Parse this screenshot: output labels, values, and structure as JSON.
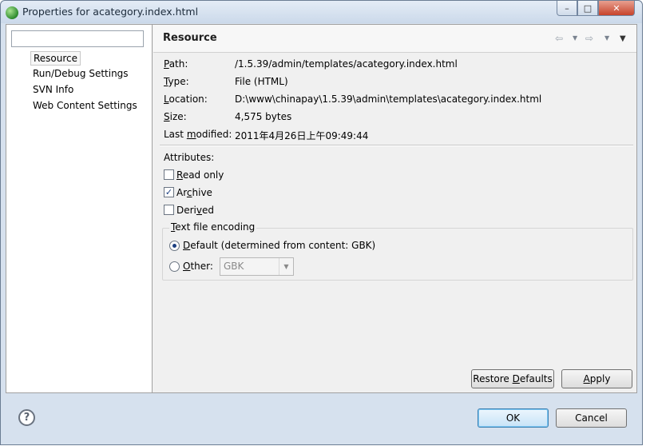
{
  "window": {
    "title": "Properties for acategory.index.html",
    "controls": {
      "minimize": "–",
      "maximize": "□",
      "close": "✕"
    }
  },
  "sidebar": {
    "filter_placeholder": "",
    "items": [
      {
        "label": "Resource",
        "selected": true
      },
      {
        "label": "Run/Debug Settings",
        "selected": false
      },
      {
        "label": "SVN Info",
        "selected": false
      },
      {
        "label": "Web Content Settings",
        "selected": false
      }
    ]
  },
  "page": {
    "title": "Resource",
    "nav_icons": {
      "back": "back-arrow-icon",
      "forward": "forward-arrow-icon",
      "menu": "view-menu-icon"
    }
  },
  "info": {
    "path": {
      "mnemonic": "P",
      "rest": "ath:",
      "value": "/1.5.39/admin/templates/acategory.index.html"
    },
    "type": {
      "mnemonic": "T",
      "rest": "ype:",
      "value": "File  (HTML)"
    },
    "location": {
      "mnemonic": "L",
      "rest": "ocation:",
      "value": "D:\\www\\chinapay\\1.5.39\\admin\\templates\\acategory.index.html"
    },
    "size": {
      "mnemonic": "S",
      "rest": "ize:",
      "value": "4,575  bytes"
    },
    "modified": {
      "before": "Last ",
      "mnemonic": "m",
      "rest": "odified:",
      "value": "2011年4月26日上午09:49:44"
    }
  },
  "attributes": {
    "heading": "Attributes:",
    "read_only": {
      "mnemonic": "R",
      "rest": "ead only",
      "checked": false
    },
    "archive": {
      "before": "Ar",
      "mnemonic": "c",
      "rest": "hive",
      "checked": true
    },
    "derived": {
      "before": "Deri",
      "mnemonic": "v",
      "rest": "ed",
      "checked": false
    }
  },
  "encoding": {
    "legend_mnemonic": "T",
    "legend_rest": "ext file encoding",
    "default_option": {
      "mnemonic": "D",
      "rest": "efault (determined from content: GBK)",
      "selected": true
    },
    "other_option": {
      "mnemonic": "O",
      "rest": "ther:",
      "selected": false
    },
    "other_value": "GBK"
  },
  "buttons": {
    "restore_before": "Restore ",
    "restore_mnemonic": "D",
    "restore_rest": "efaults",
    "apply_mnemonic": "A",
    "apply_rest": "pply",
    "ok": "OK",
    "cancel": "Cancel",
    "help": "?"
  },
  "colors": {
    "window_frame": "#d6e1ee",
    "client_bg": "#f0f0f0",
    "default_button_border": "#3c7fb1"
  }
}
